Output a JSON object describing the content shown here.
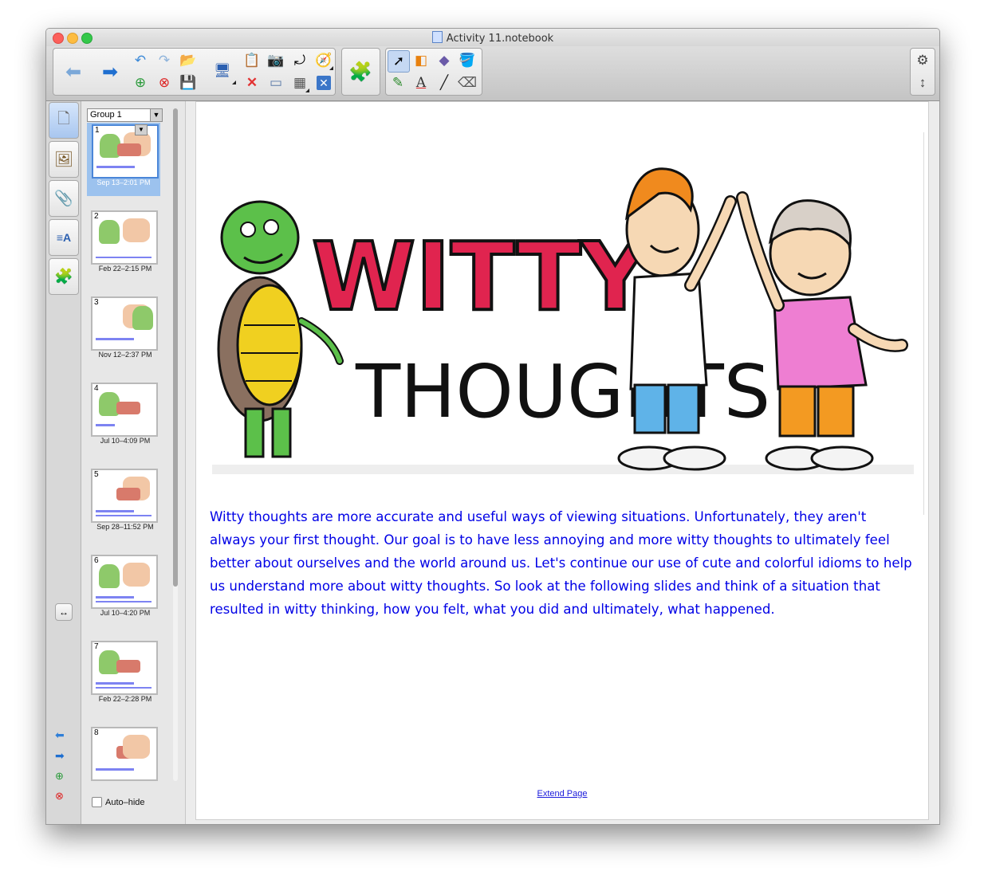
{
  "window": {
    "title": "Activity 11.notebook"
  },
  "toolbar": {
    "buttons": [
      "back-arrow",
      "forward-arrow",
      "undo",
      "redo",
      "open",
      "add-page",
      "delete-page",
      "save",
      "screen-display",
      "paste",
      "screen-capture",
      "rotate",
      "measure-tool",
      "delete",
      "screen-shade",
      "table",
      "full-screen",
      "add-ons",
      "select",
      "shapes",
      "eraser-fill",
      "fill",
      "pens",
      "text",
      "line",
      "eraser",
      "settings",
      "move-toolbar"
    ],
    "text_tool_glyph": "A"
  },
  "sorter": {
    "group_label": "Group 1",
    "pages": [
      {
        "num": "1",
        "date": "Sep 13–2:01 PM"
      },
      {
        "num": "2",
        "date": "Feb 22–2:15 PM"
      },
      {
        "num": "3",
        "date": "Nov 12–2:37 PM"
      },
      {
        "num": "4",
        "date": "Jul 10–4:09 PM"
      },
      {
        "num": "5",
        "date": "Sep 28–11:52 PM"
      },
      {
        "num": "6",
        "date": "Jul 10–4:20 PM"
      },
      {
        "num": "7",
        "date": "Feb 22–2:28 PM"
      },
      {
        "num": "8",
        "date": ""
      }
    ],
    "autohide_label": "Auto–hide"
  },
  "page": {
    "image_caption": "WITTY THOUGHTS",
    "image_line1": "WITTY",
    "image_line2": "THOUGHTS",
    "body": "Witty thoughts are more accurate and useful ways of viewing situations.  Unfortunately, they aren't always your first thought.  Our goal is to have less annoying and more witty thoughts to ultimately feel better about ourselves and the world around us.  Let's continue our use of cute and colorful idioms to help us understand more about witty thoughts.  So look at the following slides and think of a situation that resulted in witty thinking, how you felt, what you did and ultimately, what happened.",
    "extend_link": "Extend Page"
  },
  "colors": {
    "body_text": "#0000e6",
    "selection": "#9cc2ee",
    "logo_red": "#e0244f"
  }
}
